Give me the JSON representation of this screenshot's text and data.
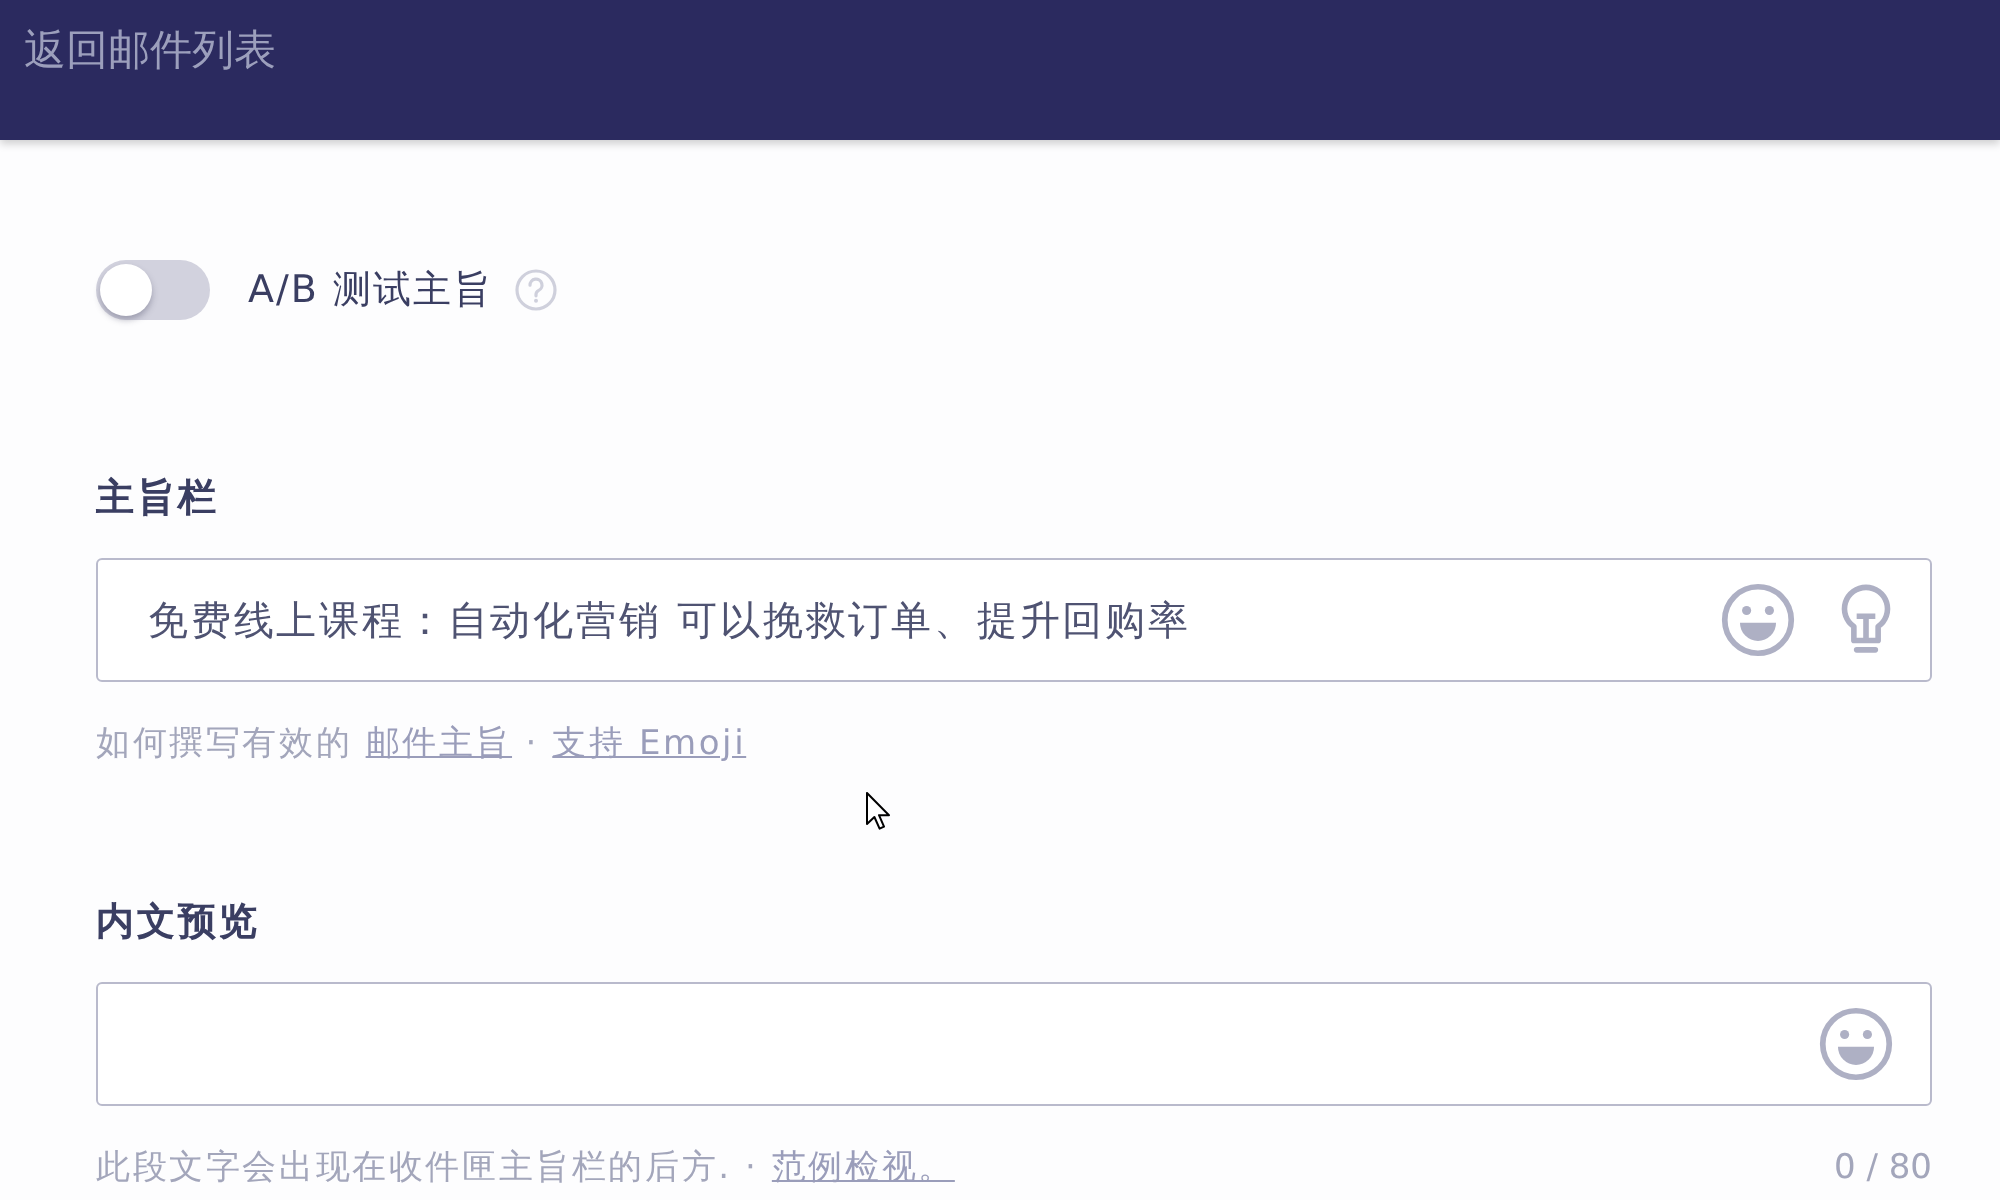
{
  "header": {
    "back_link": "返回邮件列表"
  },
  "ab_test": {
    "label": "A/B 测试主旨",
    "on": false
  },
  "subject": {
    "label": "主旨栏",
    "value": "免费线上课程：自动化营销 可以挽救订单、提升回购率",
    "hint": [
      {
        "kind": "text",
        "text": "如何撰写有效的 "
      },
      {
        "kind": "link",
        "text": "邮件主旨"
      },
      {
        "kind": "text",
        "text": " · "
      },
      {
        "kind": "link",
        "text": "支持 Emoji"
      }
    ]
  },
  "preview": {
    "label": "内文预览",
    "hint": [
      {
        "kind": "text",
        "text": "此段文字会出现在收件匣主旨栏的后方. · "
      },
      {
        "kind": "link",
        "text": "范例检视。"
      }
    ],
    "counter": "0 / 80"
  }
}
